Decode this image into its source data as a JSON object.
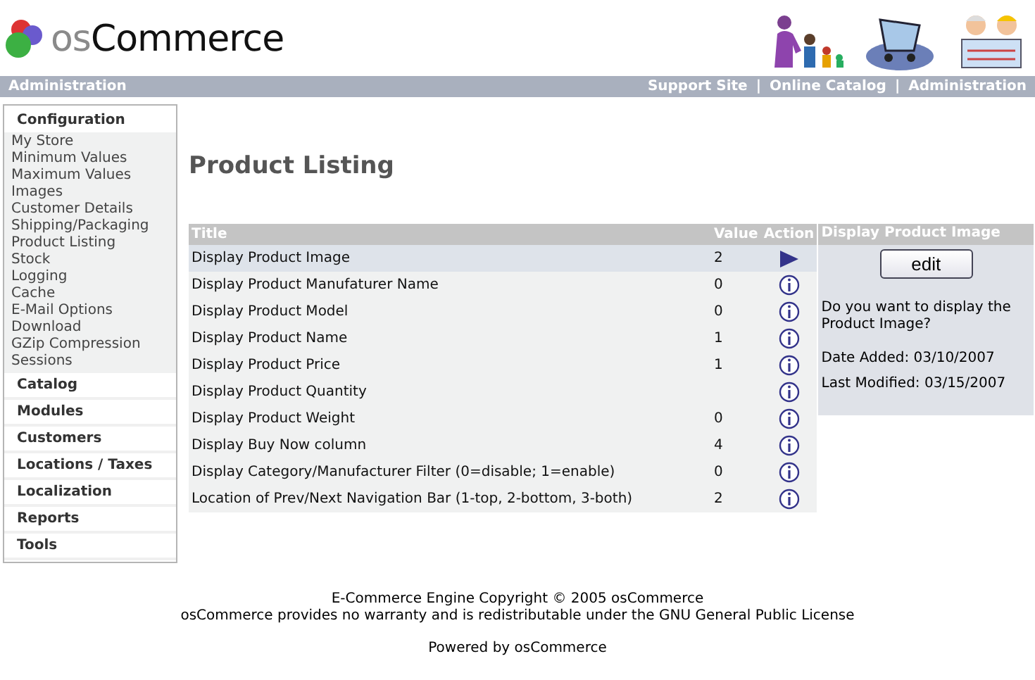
{
  "header": {
    "logo": "osCommerce"
  },
  "top_bar": {
    "left": "Administration",
    "links": [
      "Support Site",
      "Online Catalog",
      "Administration"
    ],
    "separator": "|"
  },
  "sidebar": {
    "sections": [
      {
        "title": "Configuration",
        "items": [
          "My Store",
          "Minimum Values",
          "Maximum Values",
          "Images",
          "Customer Details",
          "Shipping/Packaging",
          "Product Listing",
          "Stock",
          "Logging",
          "Cache",
          "E-Mail Options",
          "Download",
          "GZip Compression",
          "Sessions"
        ]
      },
      {
        "title": "Catalog"
      },
      {
        "title": "Modules"
      },
      {
        "title": "Customers"
      },
      {
        "title": "Locations / Taxes"
      },
      {
        "title": "Localization"
      },
      {
        "title": "Reports"
      },
      {
        "title": "Tools"
      }
    ]
  },
  "page_title": "Product Listing",
  "table": {
    "columns": [
      "Title",
      "Value",
      "Action"
    ],
    "rows": [
      {
        "title": "Display Product Image",
        "value": "2",
        "selected": true
      },
      {
        "title": "Display Product Manufaturer Name",
        "value": "0",
        "selected": false
      },
      {
        "title": "Display Product Model",
        "value": "0",
        "selected": false
      },
      {
        "title": "Display Product Name",
        "value": "1",
        "selected": false
      },
      {
        "title": "Display Product Price",
        "value": "1",
        "selected": false
      },
      {
        "title": "Display Product Quantity",
        "value": "",
        "selected": false
      },
      {
        "title": "Display Product Weight",
        "value": "0",
        "selected": false
      },
      {
        "title": "Display Buy Now column",
        "value": "4",
        "selected": false
      },
      {
        "title": "Display Category/Manufacturer Filter (0=disable; 1=enable)",
        "value": "0",
        "selected": false
      },
      {
        "title": "Location of Prev/Next Navigation Bar (1-top, 2-bottom, 3-both)",
        "value": "2",
        "selected": false
      }
    ]
  },
  "info_panel": {
    "title": "Display Product Image",
    "button": "edit",
    "description": "Do you want to display the Product Image?",
    "date_added": "Date Added: 03/10/2007",
    "last_modified": "Last Modified: 03/15/2007"
  },
  "footer": {
    "copyright": "E-Commerce Engine Copyright © 2005 osCommerce",
    "license": "osCommerce provides no warranty and is redistributable under the GNU General Public License",
    "powered": "Powered by osCommerce"
  }
}
